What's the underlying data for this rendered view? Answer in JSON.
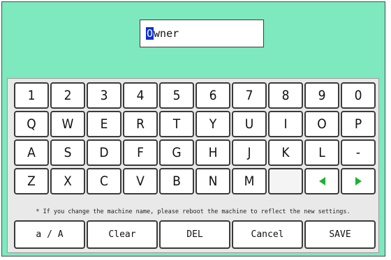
{
  "name_field": {
    "first_char": "O",
    "rest": "wner"
  },
  "keyboard": {
    "row1": [
      "1",
      "2",
      "3",
      "4",
      "5",
      "6",
      "7",
      "8",
      "9",
      "0"
    ],
    "row2": [
      "Q",
      "W",
      "E",
      "R",
      "T",
      "Y",
      "U",
      "I",
      "O",
      "P"
    ],
    "row3": [
      "A",
      "S",
      "D",
      "F",
      "G",
      "H",
      "J",
      "K",
      "L",
      "-"
    ],
    "row4": [
      "Z",
      "X",
      "C",
      "V",
      "B",
      "N",
      "M",
      "",
      "",
      ""
    ],
    "row4_arrows": {
      "left": "arrow-left-icon",
      "right": "arrow-right-icon"
    }
  },
  "note": "* If you change the machine name, please reboot the machine to reflect the new settings.",
  "buttons": {
    "case": "a / A",
    "clear": "Clear",
    "del": "DEL",
    "cancel": "Cancel",
    "save": "SAVE"
  },
  "colors": {
    "background": "#7ee8be",
    "caret": "#0b2fd6",
    "arrow": "#18b52c"
  }
}
